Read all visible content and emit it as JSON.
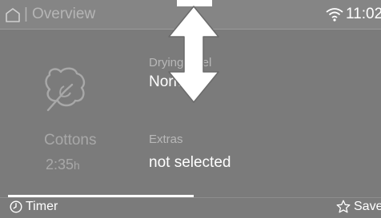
{
  "header": {
    "separator": "|",
    "title": "Overview",
    "time": "11:02",
    "home_icon": "home-icon",
    "wifi_icon": "wifi-icon"
  },
  "program": {
    "icon": "cottons-icon",
    "name": "Cottons",
    "duration_value": "2:35",
    "duration_unit": "h"
  },
  "drying": {
    "label": "Drying level",
    "value": "Normal"
  },
  "extras": {
    "label": "Extras",
    "value": "not selected"
  },
  "footer": {
    "timer_label": "Timer",
    "timer_icon": "clock-icon",
    "save_label": "Save",
    "save_icon": "star-icon"
  },
  "overlay": {
    "gesture_icon": "vertical-scroll-arrow-icon"
  },
  "colors": {
    "background": "#7b7b7b",
    "header": "#858585",
    "text_primary": "#ffffff",
    "text_muted": "#a8a8a8"
  }
}
